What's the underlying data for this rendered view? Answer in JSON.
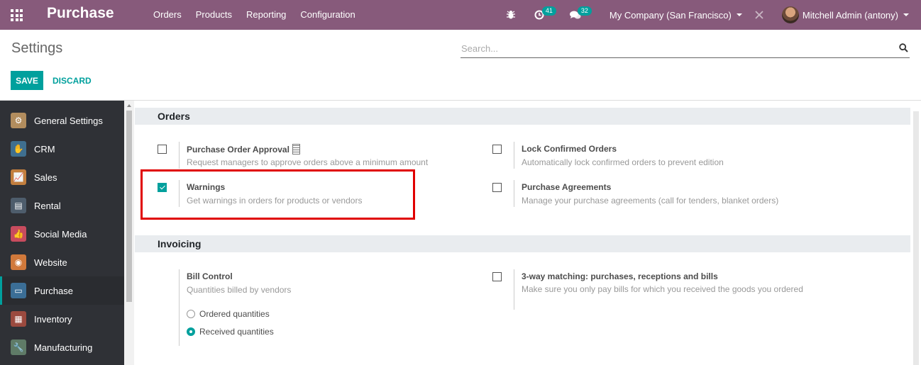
{
  "navbar": {
    "brand": "Purchase",
    "menu": [
      "Orders",
      "Products",
      "Reporting",
      "Configuration"
    ],
    "activity_count": "41",
    "message_count": "32",
    "company": "My Company (San Francisco)",
    "user": "Mitchell Admin (antony)"
  },
  "control_panel": {
    "title": "Settings",
    "search_placeholder": "Search...",
    "save_label": "SAVE",
    "discard_label": "DISCARD"
  },
  "sidebar": {
    "items": [
      {
        "label": "General Settings",
        "icon": "gear-icon",
        "color": "#b28d5e"
      },
      {
        "label": "CRM",
        "icon": "handshake-icon",
        "color": "#3f6f8f"
      },
      {
        "label": "Sales",
        "icon": "chart-icon",
        "color": "#c27e3e"
      },
      {
        "label": "Rental",
        "icon": "rental-icon",
        "color": "#4e5d6c"
      },
      {
        "label": "Social Media",
        "icon": "thumbs-up-icon",
        "color": "#c84c5e"
      },
      {
        "label": "Website",
        "icon": "globe-icon",
        "color": "#d1793b"
      },
      {
        "label": "Purchase",
        "icon": "credit-card-icon",
        "color": "#3b6e96"
      },
      {
        "label": "Inventory",
        "icon": "box-icon",
        "color": "#9b4a3f"
      },
      {
        "label": "Manufacturing",
        "icon": "wrench-icon",
        "color": "#5f7b67"
      }
    ],
    "active": "Purchase"
  },
  "orders": {
    "heading": "Orders",
    "purchase_order_approval": {
      "title": "Purchase Order Approval",
      "desc": "Request managers to approve orders above a minimum amount",
      "checked": false
    },
    "lock_confirmed_orders": {
      "title": "Lock Confirmed Orders",
      "desc": "Automatically lock confirmed orders to prevent edition",
      "checked": false
    },
    "warnings": {
      "title": "Warnings",
      "desc": "Get warnings in orders for products or vendors",
      "checked": true
    },
    "purchase_agreements": {
      "title": "Purchase Agreements",
      "desc": "Manage your purchase agreements (call for tenders, blanket orders)",
      "checked": false
    }
  },
  "invoicing": {
    "heading": "Invoicing",
    "bill_control": {
      "title": "Bill Control",
      "desc": "Quantities billed by vendors",
      "options": [
        "Ordered quantities",
        "Received quantities"
      ],
      "selected": "Received quantities"
    },
    "three_way_matching": {
      "title": "3-way matching: purchases, receptions and bills",
      "desc": "Make sure you only pay bills for which you received the goods you ordered",
      "checked": false
    }
  },
  "colors": {
    "brand": "#875a7b",
    "accent": "#00a09d",
    "highlight": "#e00000"
  }
}
